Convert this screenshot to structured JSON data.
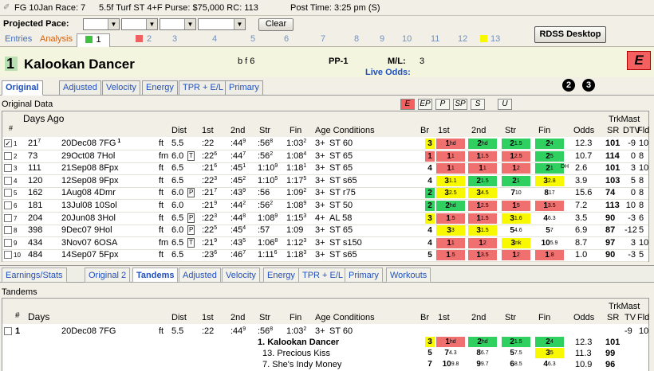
{
  "title": {
    "race": "FG 10Jan Race: 7",
    "conditions": "5.5f Turf ST 4+F  Purse: $75,000  RC: 113",
    "post_time": "Post Time: 3:25 pm  (S)"
  },
  "pace": {
    "label": "Projected Pace:",
    "clear": "Clear",
    "rdss": "RDSS Desktop"
  },
  "top_tabs": {
    "entries": "Entries",
    "analysis": "Analysis",
    "numbers": [
      "1",
      "2",
      "3",
      "4",
      "5",
      "6",
      "7",
      "8",
      "9",
      "10",
      "11",
      "12",
      "13"
    ]
  },
  "horse": {
    "number": "1",
    "name": "Kalookan Dancer",
    "sex": "b f 6",
    "pp": "PP-1",
    "ml_label": "M/L:",
    "ml_value": "3",
    "live_odds": "Live Odds:",
    "style": "E"
  },
  "detail_tabs": [
    "Original",
    "Adjusted",
    "Velocity",
    "Energy",
    "TPR + E/L",
    "Primary"
  ],
  "circles": [
    "2",
    "3"
  ],
  "original_data_label": "Original Data",
  "pace_buttons": [
    "E",
    "EP",
    "P",
    "SP",
    "S",
    "U"
  ],
  "headers": {
    "days_ago": "Days Ago",
    "hash": "#",
    "dist": "Dist",
    "c1": "1st",
    "c2": "2nd",
    "str": "Str",
    "fin": "Fin",
    "age": "Age Conditions",
    "br": "Br",
    "p1": "1st",
    "p2": "2nd",
    "pstr": "Str",
    "pfin": "Fin",
    "odds": "Odds",
    "trkmast": "TrkMast",
    "sr": "SR",
    "dtv": "DTV",
    "fld": "Fld"
  },
  "rows": [
    {
      "n": "1",
      "days": "21",
      "dsup": "7",
      "date": "20Dec08",
      "trk": "7FG",
      "sup": "1",
      "surf": "ft",
      "dist": "5.5",
      "tag": "",
      "c1": ":22",
      "c2": ":44",
      "c2s": "9",
      "cs": ":56",
      "css": "8",
      "cf": "1:03",
      "cfs": "2",
      "age": "3+",
      "cond": "ST 60",
      "br": "3",
      "p1": "1",
      "p1s": "hd",
      "p2": "2",
      "p2s": "hd",
      "ps": "2",
      "pss": "1.5",
      "pf": "2",
      "pfs": "4",
      "odds": "12.3",
      "sr": "101",
      "dtv": "-9",
      "fld": "10",
      "c": [
        "y",
        "r",
        "g",
        "g",
        "g"
      ],
      "checked": true
    },
    {
      "n": "2",
      "days": "73",
      "dsup": "",
      "date": "29Oct08",
      "trk": "7Hol",
      "sup": "",
      "surf": "fm",
      "dist": "6.0",
      "tag": "T",
      "c1": ":22",
      "c1s": "6",
      "c2": ":44",
      "c2s": "7",
      "cs": ":56",
      "css": "2",
      "cf": "1:08",
      "cfs": "4",
      "age": "3+",
      "cond": "ST 65",
      "br": "1",
      "p1": "1",
      "p1s": "1",
      "p2": "1",
      "p2s": "1.5",
      "ps": "1",
      "pss": "2.5",
      "pf": "2",
      "pfs": "5",
      "odds": "10.7",
      "sr": "114",
      "dtv": "0",
      "fld": "8",
      "c": [
        "r",
        "r",
        "r",
        "r",
        "g"
      ]
    },
    {
      "n": "3",
      "days": "111",
      "dsup": "",
      "date": "21Sep08",
      "trk": "8Fpx",
      "sup": "",
      "surf": "ft",
      "dist": "6.5",
      "tag": "",
      "c1": ":21",
      "c1s": "6",
      "c2": ":45",
      "c2s": "1",
      "cs": "1:10",
      "css": "9",
      "cf": "1:18",
      "cfs": "1",
      "age": "3+",
      "cond": "ST 65",
      "br": "4",
      "p1": "1",
      "p1s": "1",
      "p2": "1",
      "p2s": "1",
      "ps": "1",
      "pss": "2",
      "pf": "2",
      "pfs": "1",
      "odds": "2.6",
      "sr": "101",
      "dtv": "3",
      "fld": "10",
      "c": [
        "",
        "r",
        "r",
        "r",
        "g"
      ],
      "dh": "DH"
    },
    {
      "n": "4",
      "days": "120",
      "dsup": "",
      "date": "12Sep08",
      "trk": "9Fpx",
      "sup": "",
      "surf": "ft",
      "dist": "6.5",
      "tag": "",
      "c1": ":22",
      "c1s": "3",
      "c2": ":45",
      "c2s": "2",
      "cs": "1:10",
      "css": "5",
      "cf": "1:17",
      "cfs": "5",
      "age": "3+",
      "cond": "ST s65",
      "br": "4",
      "p1": "3",
      "p1s": "1.1",
      "p2": "2",
      "p2s": "1.5",
      "ps": "2",
      "pss": "1",
      "pf": "3",
      "pfs": "2.8",
      "odds": "3.9",
      "sr": "103",
      "dtv": "5",
      "fld": "8",
      "c": [
        "",
        "y",
        "g",
        "g",
        "y"
      ]
    },
    {
      "n": "5",
      "days": "162",
      "dsup": "",
      "date": "1Aug08",
      "trk": "4Dmr",
      "sup": "",
      "surf": "ft",
      "dist": "6.0",
      "tag": "P",
      "c1": ":21",
      "c1s": "7",
      "c2": ":43",
      "c2s": "9",
      "cs": ":56",
      "css": "",
      "cf": "1:09",
      "cfs": "2",
      "age": "3+",
      "cond": "ST r75",
      "br": "2",
      "p1": "3",
      "p1s": "2.5",
      "p2": "3",
      "p2s": "4.5",
      "ps": "7",
      "pss": "10",
      "pf": "8",
      "pfs": "17",
      "odds": "15.6",
      "sr": "74",
      "dtv": "0",
      "fld": "8",
      "c": [
        "g",
        "y",
        "y",
        "",
        ""
      ]
    },
    {
      "n": "6",
      "days": "181",
      "dsup": "",
      "date": "13Jul08",
      "trk": "10Sol",
      "sup": "",
      "surf": "ft",
      "dist": "6.0",
      "tag": "",
      "c1": ":21",
      "c1s": "9",
      "c2": ":44",
      "c2s": "2",
      "cs": ":56",
      "css": "2",
      "cf": "1:08",
      "cfs": "9",
      "age": "3+",
      "cond": "ST 50",
      "br": "2",
      "p1": "2",
      "p1s": "hd",
      "p2": "1",
      "p2s": "2.5",
      "ps": "1",
      "pss": "5",
      "pf": "1",
      "pfs": "3.5",
      "odds": "7.2",
      "sr": "113",
      "dtv": "10",
      "fld": "8",
      "c": [
        "g",
        "g",
        "r",
        "r",
        "r"
      ]
    },
    {
      "n": "7",
      "days": "204",
      "dsup": "",
      "date": "20Jun08",
      "trk": "3Hol",
      "sup": "",
      "surf": "ft",
      "dist": "6.5",
      "tag": "P",
      "c1": ":22",
      "c1s": "3",
      "c2": ":44",
      "c2s": "8",
      "cs": "1:08",
      "css": "9",
      "cf": "1:15",
      "cfs": "3",
      "age": "4+",
      "cond": "AL 58",
      "br": "3",
      "p1": "1",
      "p1s": ".5",
      "p2": "1",
      "p2s": "1.5",
      "ps": "3",
      "pss": "1.6",
      "pf": "4",
      "pfs": "6.3",
      "odds": "3.5",
      "sr": "90",
      "dtv": "-3",
      "fld": "6",
      "c": [
        "y",
        "r",
        "r",
        "y",
        ""
      ]
    },
    {
      "n": "8",
      "days": "398",
      "dsup": "",
      "date": "9Dec07",
      "trk": "9Hol",
      "sup": "",
      "surf": "ft",
      "dist": "6.0",
      "tag": "P",
      "c1": ":22",
      "c1s": "5",
      "c2": ":45",
      "c2s": "4",
      "cs": ":57",
      "css": "",
      "cf": "1:09",
      "cfs": "",
      "age": "3+",
      "cond": "ST 65",
      "br": "4",
      "p1": "3",
      "p1s": "3",
      "p2": "3",
      "p2s": "1.5",
      "ps": "5",
      "pss": "4.6",
      "pf": "5",
      "pfs": "7",
      "odds": "6.9",
      "sr": "87",
      "dtv": "-12",
      "fld": "5",
      "c": [
        "",
        "y",
        "y",
        "",
        ""
      ]
    },
    {
      "n": "9",
      "days": "434",
      "dsup": "",
      "date": "3Nov07",
      "trk": "6OSA",
      "sup": "",
      "surf": "fm",
      "dist": "6.5",
      "tag": "T",
      "c1": ":21",
      "c1s": "9",
      "c2": ":43",
      "c2s": "5",
      "cs": "1:06",
      "css": "8",
      "cf": "1:12",
      "cfs": "3",
      "age": "3+",
      "cond": "ST s150",
      "br": "4",
      "p1": "1",
      "p1s": "1",
      "p2": "1",
      "p2s": "2",
      "ps": "3",
      "pss": "nk",
      "pf": "10",
      "pfs": "5.9",
      "odds": "8.7",
      "sr": "97",
      "dtv": "3",
      "fld": "10",
      "c": [
        "",
        "r",
        "r",
        "y",
        ""
      ]
    },
    {
      "n": "10",
      "days": "484",
      "dsup": "",
      "date": "14Sep07",
      "trk": "5Fpx",
      "sup": "",
      "surf": "ft",
      "dist": "6.5",
      "tag": "",
      "c1": ":23",
      "c1s": "6",
      "c2": ":46",
      "c2s": "7",
      "cs": "1:11",
      "css": "6",
      "cf": "1:18",
      "cfs": "3",
      "age": "3+",
      "cond": "ST s65",
      "br": "5",
      "p1": "1",
      "p1s": ".5",
      "p2": "1",
      "p2s": "3.5",
      "ps": "1",
      "pss": "2",
      "pf": "1",
      "pfs": ".8",
      "odds": "1.0",
      "sr": "90",
      "dtv": "-3",
      "fld": "5",
      "c": [
        "",
        "r",
        "r",
        "r",
        "r"
      ]
    }
  ],
  "bottom_tabs": [
    "Earnings/Stats",
    "Original 2",
    "Tandems",
    "Adjusted",
    "Velocity",
    "Energy",
    "TPR + E/L",
    "Primary",
    "Workouts"
  ],
  "tandems": {
    "label": "Tandems",
    "h_hash": "#",
    "h_days": "Days",
    "h_dist": "Dist",
    "h_1st": "1st",
    "h_2nd": "2nd",
    "h_str": "Str",
    "h_fin": "Fin",
    "h_age": "Age Conditions",
    "h_br": "Br",
    "h_p1": "1st",
    "h_p2": "2nd",
    "h_pstr": "Str",
    "h_pfin": "Fin",
    "h_odds": "Odds",
    "h_trkmast": "TrkMast",
    "h_sr": "SR",
    "h_tv": "TV",
    "h_fld": "Fld",
    "race": {
      "n": "1",
      "date": "20Dec08",
      "trk": "7FG",
      "surf": "ft",
      "dist": "5.5",
      "c1": ":22",
      "c2": ":44",
      "c2s": "9",
      "cs": ":56",
      "css": "8",
      "cf": "1:03",
      "cfs": "2",
      "age": "3+",
      "cond": "ST 60",
      "tv": "-9",
      "fld": "10"
    },
    "horses": [
      {
        "label": "1.  Kalookan Dancer",
        "br": "3",
        "p1": "1",
        "p1s": "hd",
        "p2": "2",
        "p2s": "hd",
        "ps": "2",
        "pss": "1.5",
        "pf": "2",
        "pfs": "4",
        "odds": "12.3",
        "sr": "101",
        "bold": true
      },
      {
        "label": "13.  Precious Kiss",
        "br": "5",
        "p1": "7",
        "p1s": "4.3",
        "p2": "8",
        "p2s": "6.7",
        "ps": "5",
        "pss": "7.5",
        "pf": "3",
        "pfs": "5",
        "odds": "11.3",
        "sr": "99"
      },
      {
        "label": "7.  She's Indy Money",
        "br": "7",
        "p1": "10",
        "p1s": "9.8",
        "p2": "9",
        "p2s": "9.7",
        "ps": "6",
        "pss": "8.5",
        "pf": "4",
        "pfs": "6.3",
        "odds": "10.9",
        "sr": "96"
      }
    ]
  }
}
